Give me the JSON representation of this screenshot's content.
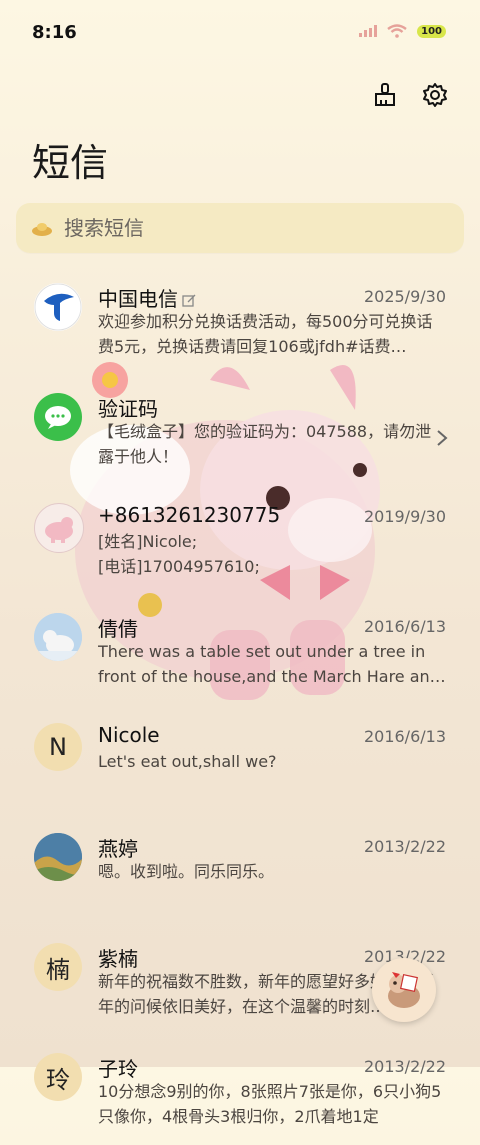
{
  "status_bar": {
    "time": "8:16",
    "battery": "100"
  },
  "header": {
    "title": "短信"
  },
  "search": {
    "placeholder": "搜索短信"
  },
  "conversations": [
    {
      "name": "中国电信",
      "date": "2025/9/30",
      "preview": "欢迎参加积分兑换话费活动，每500分可兑换话费5元，兑换话费请回复106或jfdh#话费…",
      "avatar_icon": "china-telecom-logo"
    },
    {
      "name": "验证码",
      "date": "",
      "preview": "【毛绒盒子】您的验证码为：047588，请勿泄露于他人！",
      "avatar_icon": "sms-bubble-icon"
    },
    {
      "name": "+8613261230775",
      "date": "2019/9/30",
      "preview_lines": [
        "[姓名]Nicole;",
        "[电话]17004957610;"
      ],
      "avatar_icon": "pony-avatar"
    },
    {
      "name": "倩倩",
      "date": "2016/6/13",
      "preview": "There was a table set out under a tree in front of the house,and the March Hare an…",
      "avatar_icon": "polar-bear-photo"
    },
    {
      "name": "Nicole",
      "date": "2016/6/13",
      "preview": "Let's eat out,shall we?",
      "avatar_letter": "N"
    },
    {
      "name": "燕婷",
      "date": "2013/2/22",
      "preview": "嗯。收到啦。同乐同乐。",
      "avatar_icon": "landscape-photo"
    },
    {
      "name": "紫楠",
      "date": "2013/2/22",
      "preview": "新年的祝福数不胜数，新年的愿望好多好多，新年的问候依旧美好，在这个温馨的时刻…",
      "avatar_letter": "楠"
    },
    {
      "name": "子玲",
      "date": "2013/2/22",
      "preview": "10分想念9别的你，8张照片7张是你，6只小狗5只像你，4根骨头3根归你，2爪着地1定",
      "avatar_letter": "玲"
    }
  ],
  "colors": {
    "accent": "#e8d9a8",
    "avatar_bg": "#f2deb0",
    "telecom_blue": "#1e5fbf",
    "sms_green": "#3bbf4a"
  }
}
